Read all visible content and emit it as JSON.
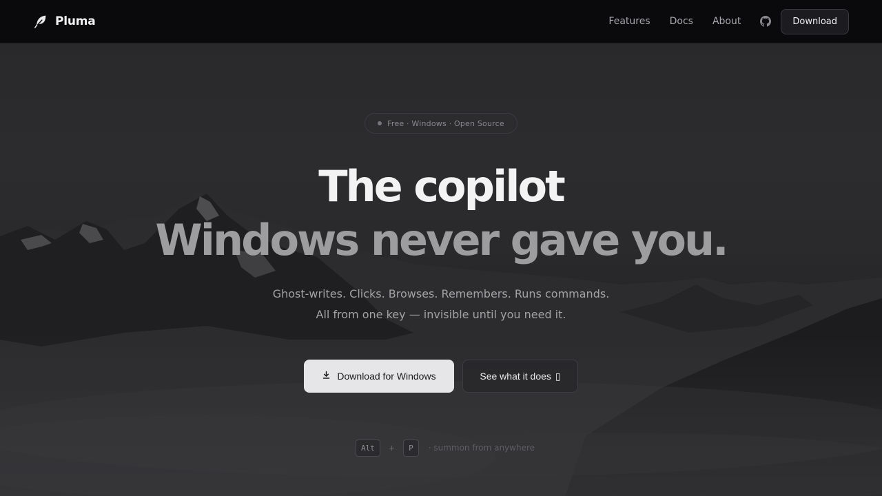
{
  "nav": {
    "brand": "Pluma",
    "links": [
      "Features",
      "Docs",
      "About"
    ],
    "download_label": "Download",
    "icons": {
      "brand": "feather-icon",
      "github": "github-icon"
    }
  },
  "hero": {
    "pill_text": "Free · Windows · Open Source",
    "title_line1": "The copilot",
    "title_line2": "Windows never gave you.",
    "subtitle_line1": "Ghost-writes. Clicks. Browses. Remembers. Runs commands.",
    "subtitle_line2": "All from one key — invisible until you need it.",
    "primary_button": "Download for Windows",
    "secondary_button": "See what it does",
    "secondary_button_glyph": "▯",
    "shortcut": {
      "key1": "Alt",
      "plus": "+",
      "key2": "P",
      "caption": "· summon from anywhere"
    }
  },
  "colors": {
    "background": "#0c0c0e",
    "hero_bg": "#2a2a2c",
    "primary_button_bg": "#e6e6e8",
    "title_primary": "#f3f3f4",
    "title_secondary": "#9d9d9f"
  }
}
